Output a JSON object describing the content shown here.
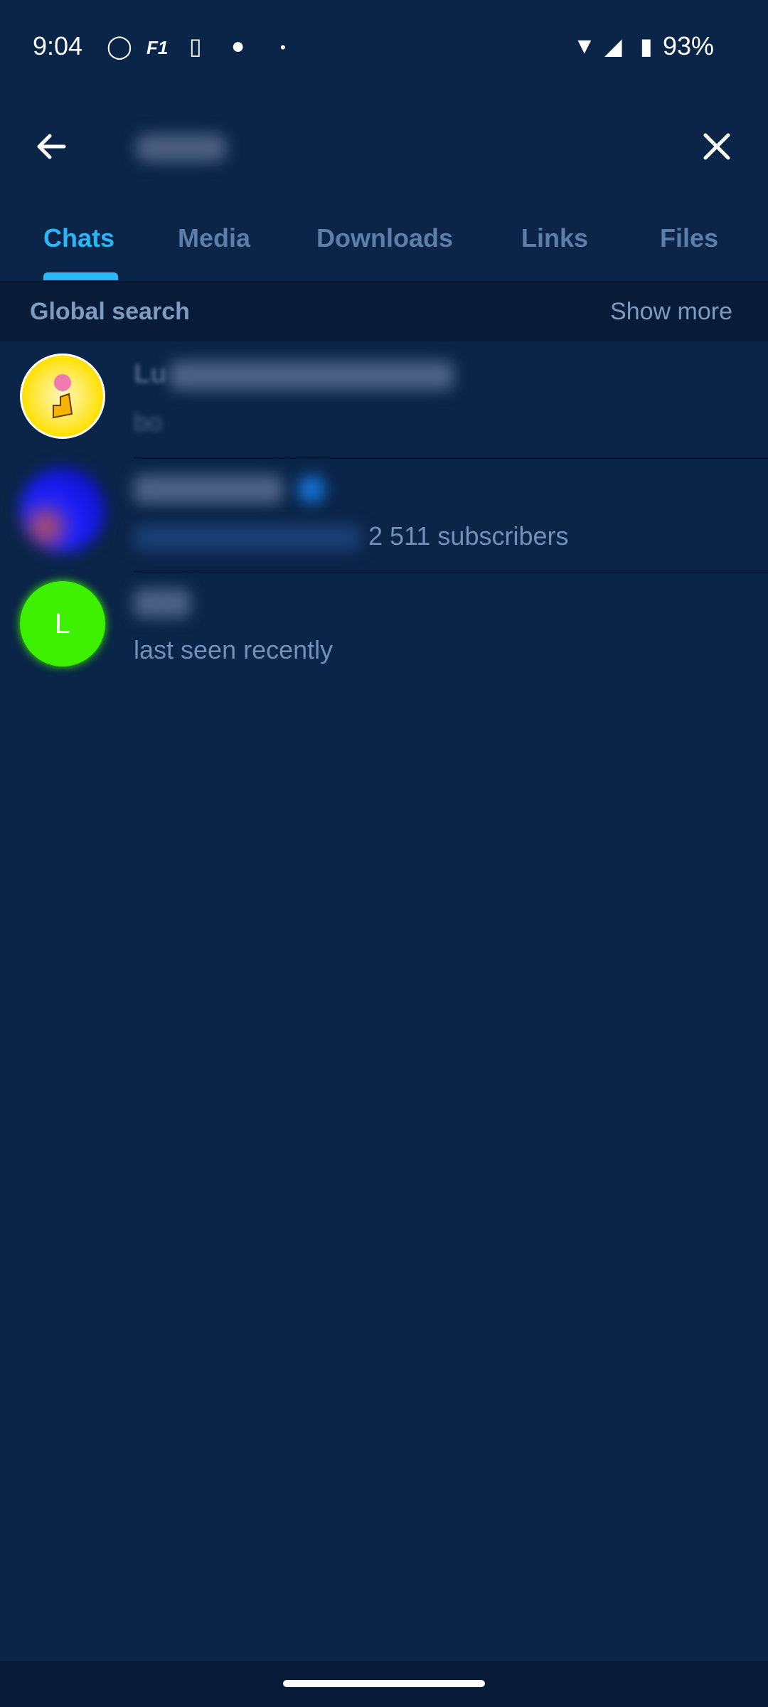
{
  "status_bar": {
    "time": "9:04",
    "battery": "93%",
    "icons": [
      "whatsapp-icon",
      "f1-icon",
      "notification-app-icon",
      "ghost-app-icon",
      "more-dot-icon",
      "wifi-icon",
      "signal-icon",
      "battery-icon"
    ]
  },
  "toolbar": {
    "query": "",
    "back_icon": "arrow-left-icon",
    "close_icon": "close-icon"
  },
  "tabs": [
    {
      "label": "Chats",
      "active": true
    },
    {
      "label": "Media"
    },
    {
      "label": "Downloads"
    },
    {
      "label": "Links"
    },
    {
      "label": "Files"
    }
  ],
  "global_search": {
    "label": "Global search",
    "action": "Show more"
  },
  "results": [
    {
      "name": "Lu",
      "subtitle": "bo",
      "avatar_color": "#ffe000"
    },
    {
      "name": "",
      "subtitle": "2 511 subscribers",
      "avatar_color": "#1d22ff"
    },
    {
      "name": "",
      "subtitle": "last seen recently",
      "avatar_letter": "L",
      "avatar_color": "#3cf000"
    }
  ],
  "colors": {
    "background": "#0b2548",
    "accent": "#2ab7f5"
  }
}
